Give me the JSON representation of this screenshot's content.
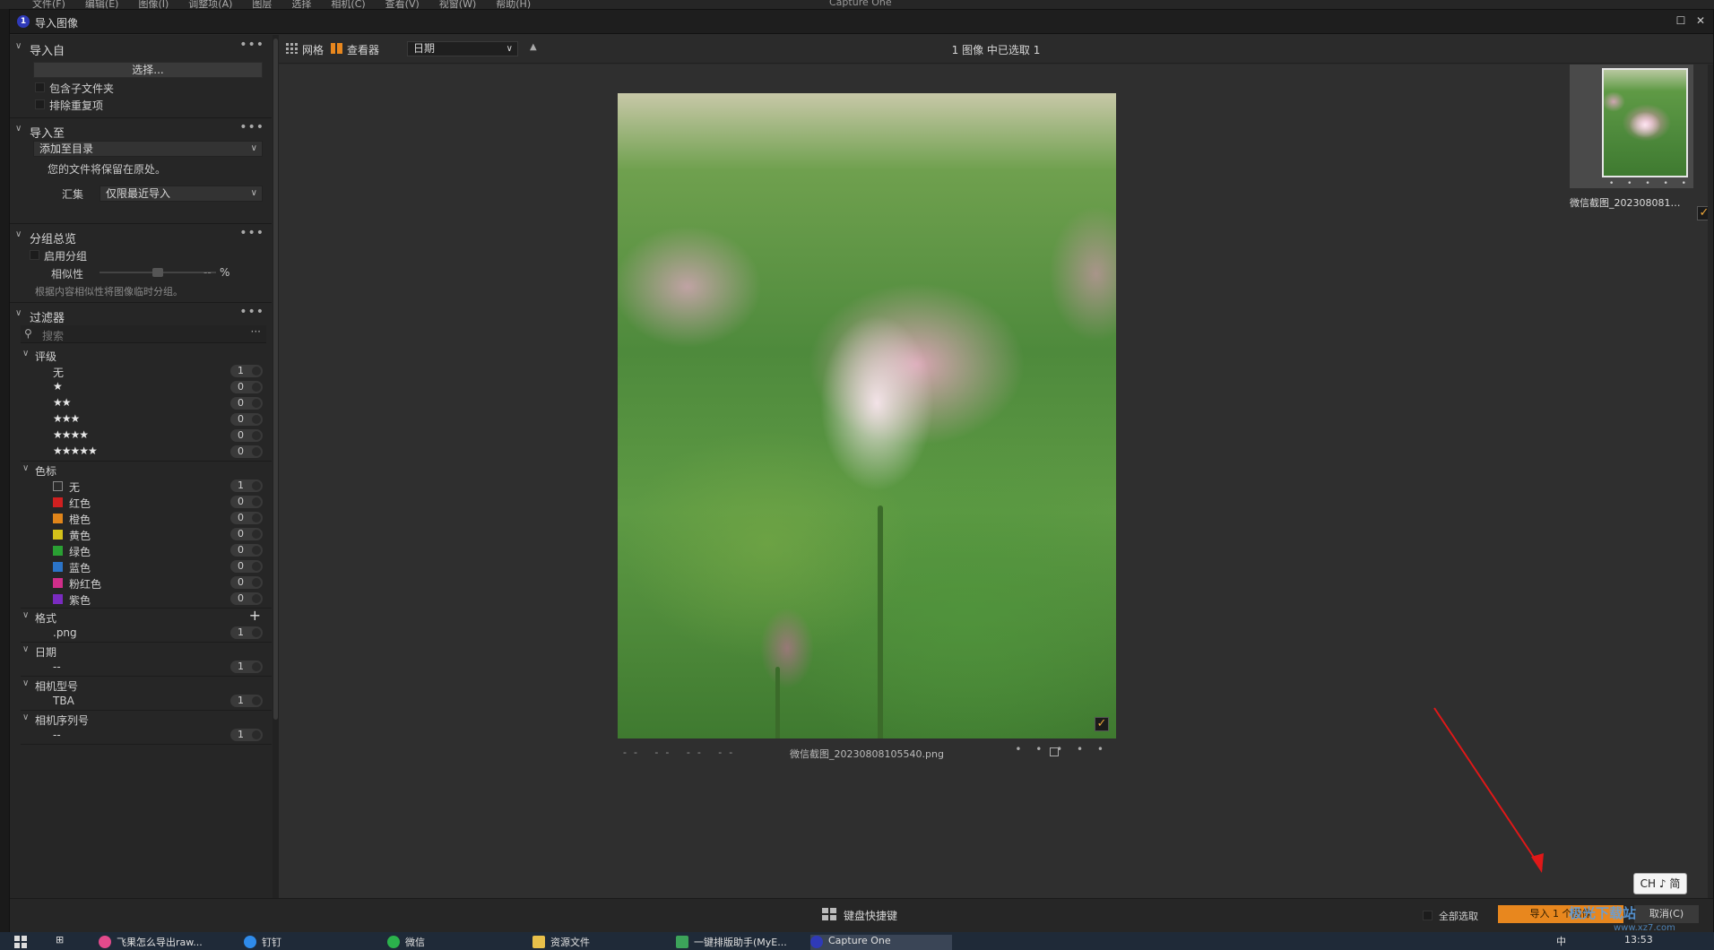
{
  "app": {
    "menu": [
      "文件(F)",
      "编辑(E)",
      "图像(I)",
      "调整项(A)",
      "图层",
      "选择",
      "相机(C)",
      "查看(V)",
      "视窗(W)",
      "帮助(H)"
    ],
    "title": "Capture One"
  },
  "dialog": {
    "title": "导入图像"
  },
  "import_from": {
    "header": "导入自",
    "select_button": "选择...",
    "include_subfolders": "包含子文件夹",
    "exclude_duplicates": "排除重复项"
  },
  "import_to": {
    "header": "导入至",
    "destination": "添加至目录",
    "note": "您的文件将保留在原处。",
    "collection_label": "汇集",
    "collection_value": "仅限最近导入"
  },
  "grouping": {
    "header": "分组总览",
    "enable": "启用分组",
    "similarity_label": "相似性",
    "similarity_value": "--",
    "similarity_unit": "%",
    "similarity_level": 0.5,
    "hint": "根据内容相似性将图像临时分组。"
  },
  "filters": {
    "header": "过滤器",
    "search_placeholder": "搜索",
    "rating": {
      "label": "评级",
      "items": [
        {
          "label": "无",
          "stars": "",
          "count": "1"
        },
        {
          "label": "",
          "stars": "★",
          "count": "0"
        },
        {
          "label": "",
          "stars": "★★",
          "count": "0"
        },
        {
          "label": "",
          "stars": "★★★",
          "count": "0"
        },
        {
          "label": "",
          "stars": "★★★★",
          "count": "0"
        },
        {
          "label": "",
          "stars": "★★★★★",
          "count": "0"
        }
      ]
    },
    "color_tag": {
      "label": "色标",
      "items": [
        {
          "label": "无",
          "color": "#2b2b2b",
          "count": "1"
        },
        {
          "label": "红色",
          "color": "#d02020",
          "count": "0"
        },
        {
          "label": "橙色",
          "color": "#e0851a",
          "count": "0"
        },
        {
          "label": "黄色",
          "color": "#d4c21a",
          "count": "0"
        },
        {
          "label": "绿色",
          "color": "#2aa033",
          "count": "0"
        },
        {
          "label": "蓝色",
          "color": "#2b74c8",
          "count": "0"
        },
        {
          "label": "粉红色",
          "color": "#d02e8a",
          "count": "0"
        },
        {
          "label": "紫色",
          "color": "#7a2bc0",
          "count": "0"
        }
      ]
    },
    "format": {
      "label": "格式",
      "items": [
        {
          "label": ".png",
          "count": "1"
        }
      ]
    },
    "date": {
      "label": "日期",
      "items": [
        {
          "label": "--",
          "count": "1"
        }
      ]
    },
    "camera_model": {
      "label": "相机型号",
      "items": [
        {
          "label": "TBA",
          "count": "1"
        }
      ]
    },
    "camera_serial": {
      "label": "相机序列号",
      "items": [
        {
          "label": "--",
          "count": "1"
        }
      ]
    }
  },
  "toolbar": {
    "grid_label": "网格",
    "viewer_label": "查看器",
    "sort_value": "日期",
    "sort_direction": "▲",
    "selection_status": "1 图像 中已选取 1"
  },
  "viewer": {
    "filename": "微信截图_20230808105540.png",
    "meta": "-- -- -- --",
    "rating_dots": "• • • • •"
  },
  "filmstrip": {
    "thumb_name": "微信截图_202308081055...",
    "thumb_dots": "• • • • •"
  },
  "bottom": {
    "keyboard_shortcuts": "键盘快捷键",
    "select_all": "全部选取",
    "import_button": "导入 1 个图像",
    "cancel_button": "取消(C)"
  },
  "ime": {
    "label": "CH ♪ 简"
  },
  "taskbar": {
    "tasks": [
      "飞果怎么导出raw...",
      "钉钉",
      "微信",
      "资源文件",
      "一键排版助手(MyE...",
      "Capture One"
    ],
    "time": "13:53",
    "lang": "中"
  },
  "colors": {
    "accent": "#e8871e",
    "check": "#f0a83a",
    "annotation": "#e01818"
  },
  "watermark": {
    "text": "极光下载站",
    "url": "www.xz7.com"
  }
}
